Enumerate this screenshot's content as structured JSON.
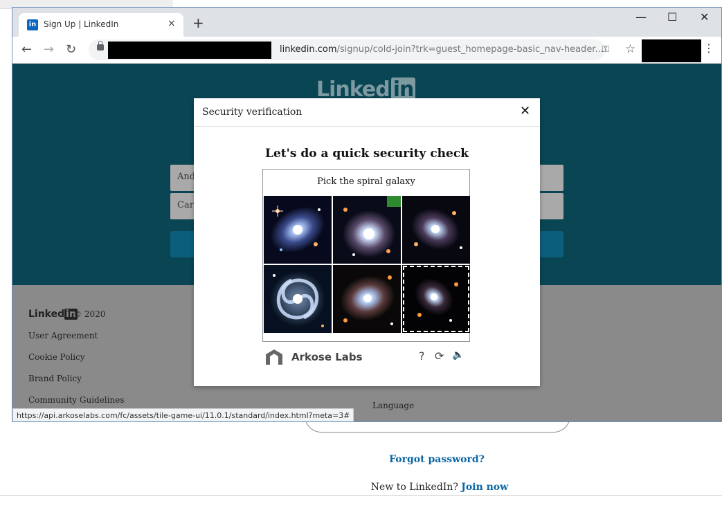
{
  "browser": {
    "tab_title": "Sign Up | LinkedIn",
    "tab_close": "×",
    "new_tab": "+",
    "url_host": "linkedin.com",
    "url_path": "/signup/cold-join?trk=guest_homepage-basic_nav-header...",
    "status_url": "https://api.arkoselabs.com/fc/assets/tile-game-ui/11.0.1/standard/index.html?meta=3#"
  },
  "background_page": {
    "forgot_password": "Forgot password?",
    "new_to_linkedin": "New to LinkedIn?",
    "join_now": "Join now"
  },
  "page": {
    "logo_text": "Linked",
    "logo_in": "in",
    "field1_partial": "Andr",
    "field2_partial": "Carr",
    "footer": {
      "logo_text": "Linked",
      "logo_in": "in",
      "copyright": "© 2020",
      "links": [
        "User Agreement",
        "Cookie Policy",
        "Brand Policy",
        "Community Guidelines"
      ],
      "language": "Language"
    }
  },
  "modal": {
    "title": "Security verification",
    "close": "✕",
    "heading": "Let's do a quick security check",
    "prompt": "Pick the spiral galaxy",
    "provider": "Arkose Labs",
    "help": "?",
    "refresh": "⟳",
    "audio": "🔊",
    "tiles": [
      {
        "label": "galaxy-tile-1"
      },
      {
        "label": "galaxy-tile-2"
      },
      {
        "label": "galaxy-tile-3"
      },
      {
        "label": "galaxy-tile-4-spiral"
      },
      {
        "label": "galaxy-tile-5"
      },
      {
        "label": "galaxy-tile-6-selected"
      }
    ]
  },
  "colors": {
    "hero": "#0a4553",
    "linkedin_blue": "#0a66a4",
    "overlay_gray": "#8a8a8a"
  }
}
